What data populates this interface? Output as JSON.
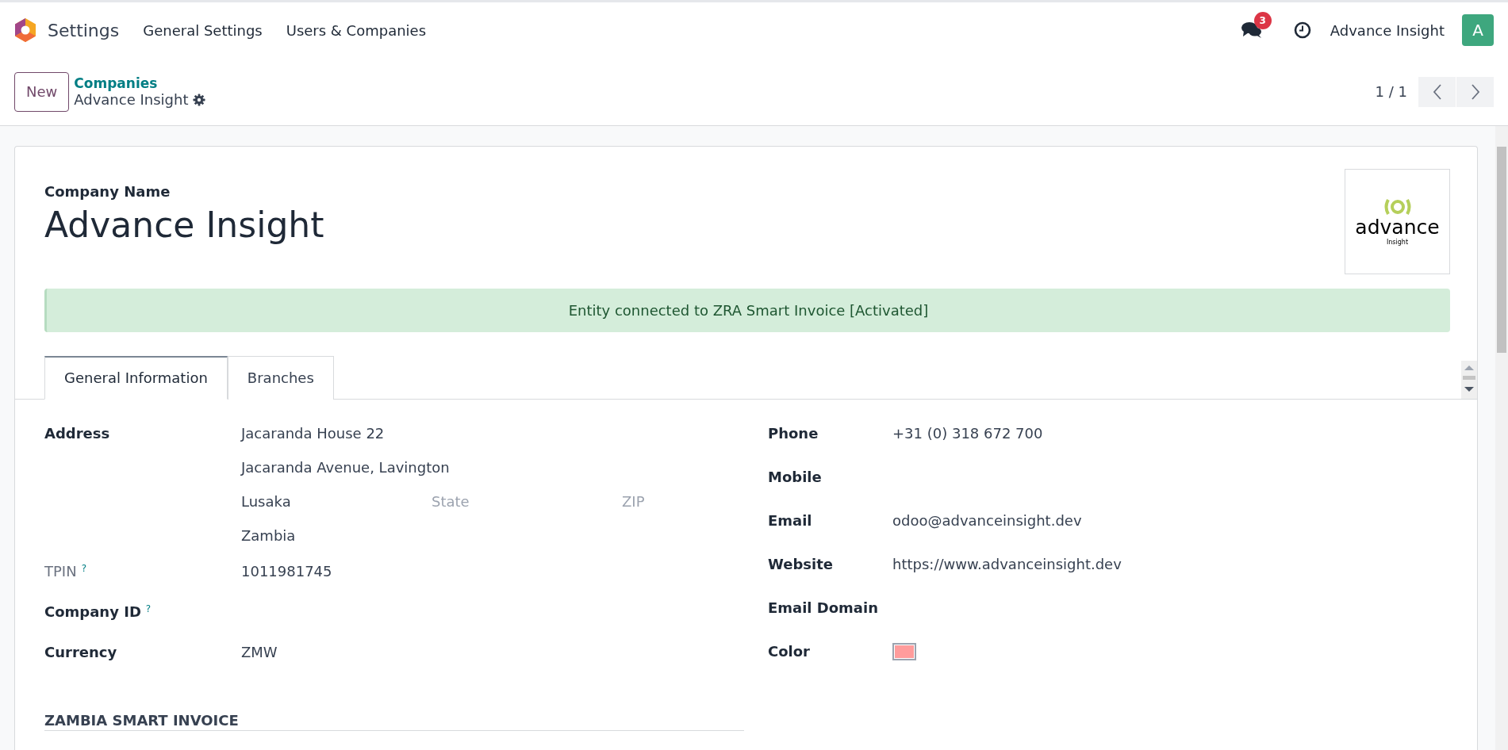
{
  "navbar": {
    "app_name": "Settings",
    "menus": [
      "General Settings",
      "Users & Companies"
    ],
    "messages_count": "3",
    "user_name": "Advance Insight",
    "avatar_letter": "A"
  },
  "control_panel": {
    "new_button": "New",
    "breadcrumb_parent": "Companies",
    "breadcrumb_current": "Advance Insight",
    "pager": "1 / 1"
  },
  "form": {
    "name_label": "Company Name",
    "name": "Advance Insight",
    "logo": {
      "wordmark": "advance",
      "tagline": "Insight"
    },
    "alert": "Entity connected to ZRA Smart Invoice [Activated]",
    "tabs": [
      {
        "label": "General Information",
        "selected": true
      },
      {
        "label": "Branches",
        "selected": false
      }
    ],
    "address": {
      "label": "Address",
      "street": "Jacaranda House 22",
      "street2": "Jacaranda Avenue, Lavington",
      "city": "Lusaka",
      "state_placeholder": "State",
      "zip_placeholder": "ZIP",
      "country": "Zambia"
    },
    "left_fields": [
      {
        "label": "TPIN",
        "help": "?",
        "muted": true,
        "value": "1011981745"
      },
      {
        "label": "Company ID",
        "help": "?",
        "muted": false
      },
      {
        "label": "Currency",
        "muted": false,
        "value": "ZMW"
      }
    ],
    "right_fields": [
      {
        "label": "Phone",
        "kind": "text",
        "value": "+31 (0) 318 672 700"
      },
      {
        "label": "Mobile",
        "kind": "text"
      },
      {
        "label": "Email",
        "kind": "text",
        "value": "odoo@advanceinsight.dev"
      },
      {
        "label": "Website",
        "kind": "text",
        "value": "https://www.advanceinsight.dev"
      },
      {
        "label": "Email Domain",
        "kind": "text"
      },
      {
        "label": "Color",
        "kind": "swatch",
        "color": "#ff9c9c"
      }
    ],
    "section_title": "ZAMBIA SMART INVOICE"
  }
}
